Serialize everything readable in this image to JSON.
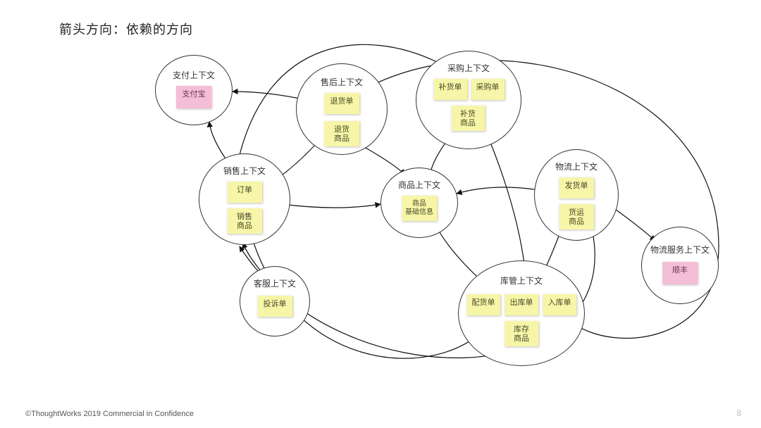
{
  "title": "箭头方向：依赖的方向",
  "footer": "©ThoughtWorks 2019 Commercial in Confidence",
  "page_number": "8",
  "contexts": {
    "payment": {
      "label": "支付上下文",
      "notes": [
        {
          "text": "支付宝",
          "color": "pink"
        }
      ]
    },
    "aftersale": {
      "label": "售后上下文",
      "notes": [
        {
          "text": "退货单",
          "color": "yellow"
        },
        {
          "text": "退货\n商品",
          "color": "yellow"
        }
      ]
    },
    "purchase": {
      "label": "采购上下文",
      "notes": [
        {
          "text": "补货单",
          "color": "yellow"
        },
        {
          "text": "采购单",
          "color": "yellow"
        },
        {
          "text": "补货\n商品",
          "color": "yellow"
        }
      ]
    },
    "sales": {
      "label": "销售上下文",
      "notes": [
        {
          "text": "订单",
          "color": "yellow"
        },
        {
          "text": "销售\n商品",
          "color": "yellow"
        }
      ]
    },
    "product": {
      "label": "商品上下文",
      "notes": [
        {
          "text": "商品\n基础信息",
          "color": "yellow"
        }
      ]
    },
    "logistics": {
      "label": "物流上下文",
      "notes": [
        {
          "text": "发货单",
          "color": "yellow"
        },
        {
          "text": "货运\n商品",
          "color": "yellow"
        }
      ]
    },
    "warehouse": {
      "label": "库管上下文",
      "notes": [
        {
          "text": "配货单",
          "color": "yellow"
        },
        {
          "text": "出库单",
          "color": "yellow"
        },
        {
          "text": "入库单",
          "color": "yellow"
        },
        {
          "text": "库存\n商品",
          "color": "yellow"
        }
      ]
    },
    "service": {
      "label": "客服上下文",
      "notes": [
        {
          "text": "投诉单",
          "color": "yellow"
        }
      ]
    },
    "courier": {
      "label": "物流服务上下文",
      "notes": [
        {
          "text": "顺丰",
          "color": "pink"
        }
      ]
    }
  },
  "edges_description": "Directed dependency arrows between contexts (arrow direction = dependency direction).",
  "edges": [
    [
      "sales",
      "payment"
    ],
    [
      "aftersale",
      "payment"
    ],
    [
      "aftersale",
      "sales"
    ],
    [
      "aftersale",
      "product"
    ],
    [
      "aftersale",
      "warehouse"
    ],
    [
      "purchase",
      "product"
    ],
    [
      "purchase",
      "warehouse"
    ],
    [
      "purchase",
      "sales"
    ],
    [
      "sales",
      "product"
    ],
    [
      "sales",
      "warehouse"
    ],
    [
      "logistics",
      "product"
    ],
    [
      "logistics",
      "warehouse"
    ],
    [
      "logistics",
      "courier"
    ],
    [
      "logistics",
      "sales"
    ],
    [
      "warehouse",
      "product"
    ],
    [
      "service",
      "sales"
    ]
  ]
}
